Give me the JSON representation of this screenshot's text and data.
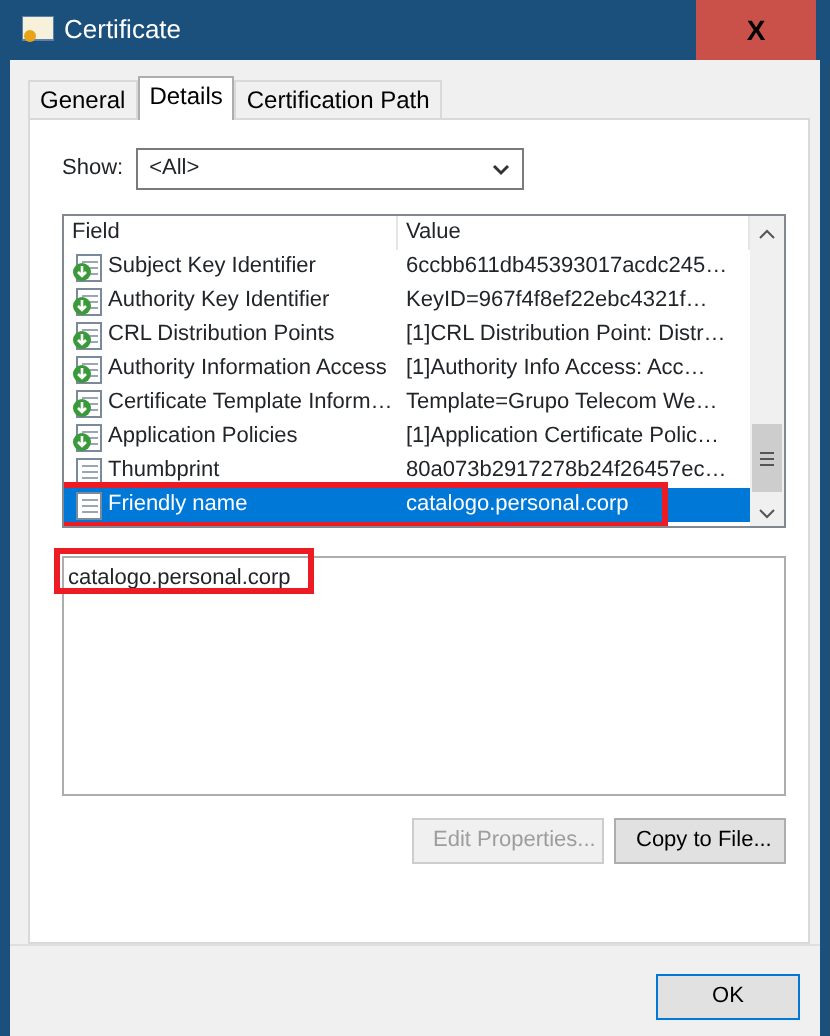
{
  "window": {
    "title": "Certificate",
    "close": "X"
  },
  "tabs": [
    {
      "label": "General",
      "selected": false
    },
    {
      "label": "Details",
      "selected": true
    },
    {
      "label": "Certification Path",
      "selected": false
    }
  ],
  "show": {
    "label": "Show:",
    "value": "<All>"
  },
  "table": {
    "columns": [
      "Field",
      "Value"
    ],
    "rows": [
      {
        "kind": "extension",
        "field": "Subject Key Identifier",
        "value": "6ccbb611db45393017acdc245…",
        "selected": false,
        "highlighted": false
      },
      {
        "kind": "extension",
        "field": "Authority Key Identifier",
        "value": "KeyID=967f4f8ef22ebc4321f…",
        "selected": false,
        "highlighted": false
      },
      {
        "kind": "extension",
        "field": "CRL Distribution Points",
        "value": "[1]CRL Distribution Point: Distr…",
        "selected": false,
        "highlighted": false
      },
      {
        "kind": "extension",
        "field": "Authority Information Access",
        "value": "[1]Authority Info Access: Acc…",
        "selected": false,
        "highlighted": false
      },
      {
        "kind": "extension",
        "field": "Certificate Template Inform…",
        "value": "Template=Grupo Telecom We…",
        "selected": false,
        "highlighted": false
      },
      {
        "kind": "extension",
        "field": "Application Policies",
        "value": "[1]Application Certificate Polic…",
        "selected": false,
        "highlighted": false
      },
      {
        "kind": "property",
        "field": "Thumbprint",
        "value": "80a073b2917278b24f26457ec…",
        "selected": false,
        "highlighted": false
      },
      {
        "kind": "property",
        "field": "Friendly name",
        "value": "catalogo.personal.corp",
        "selected": true,
        "highlighted": true
      }
    ]
  },
  "detail": {
    "value": "catalogo.personal.corp",
    "highlighted": true
  },
  "buttons": [
    {
      "label": "Edit Properties...",
      "disabled": true
    },
    {
      "label": "Copy to File...",
      "disabled": false
    }
  ],
  "footer": {
    "ok": "OK"
  }
}
